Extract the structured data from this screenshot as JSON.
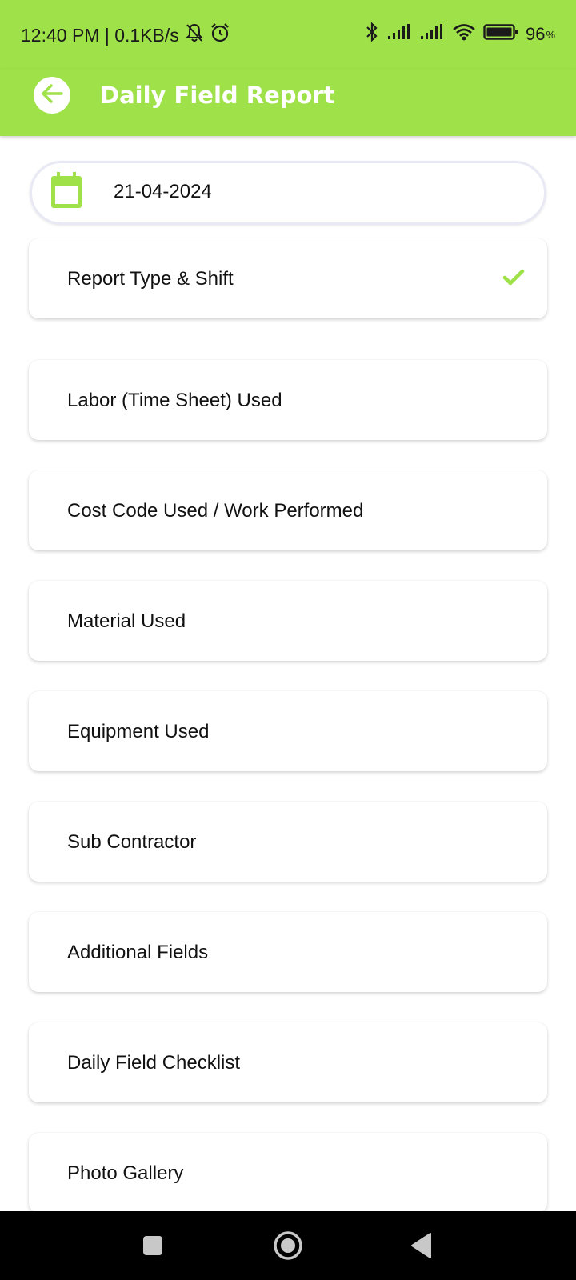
{
  "status_bar": {
    "time_speed": "12:40 PM | 0.1KB/s",
    "battery_percent": "96",
    "battery_percent_sign": "%",
    "icons": [
      "mute-bell-icon",
      "alarm-icon",
      "bluetooth-icon",
      "signal-icon",
      "signal-icon",
      "wifi-icon",
      "battery-icon"
    ]
  },
  "header": {
    "title": "Daily Field Report",
    "back_icon": "arrow-left-icon"
  },
  "date_field": {
    "value": "21-04-2024",
    "icon": "calendar-icon"
  },
  "sections": [
    {
      "label": "Report Type & Shift",
      "completed": true
    },
    {
      "label": "Labor (Time Sheet) Used",
      "completed": false
    },
    {
      "label": "Cost Code Used / Work Performed",
      "completed": false
    },
    {
      "label": "Material Used",
      "completed": false
    },
    {
      "label": "Equipment Used",
      "completed": false
    },
    {
      "label": "Sub Contractor",
      "completed": false
    },
    {
      "label": "Additional Fields",
      "completed": false
    },
    {
      "label": "Daily Field Checklist",
      "completed": false
    },
    {
      "label": "Photo Gallery",
      "completed": false
    }
  ],
  "nav_bar": {
    "buttons": [
      "recents-square-icon",
      "home-circle-icon",
      "back-triangle-icon"
    ]
  },
  "colors": {
    "accent": "#9fe149",
    "white": "#ffffff",
    "nav": "#000000"
  }
}
